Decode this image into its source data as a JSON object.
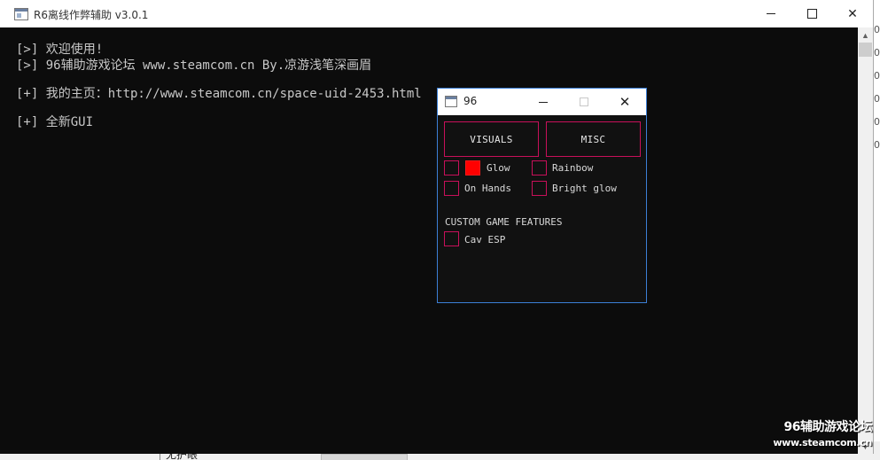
{
  "console_window": {
    "title": "R6离线作弊辅助 v3.0.1",
    "lines": [
      "[>] 欢迎使用!",
      "[>] 96辅助游戏论坛 www.steamcom.cn By.凉游浅笔深画眉",
      "[+] 我的主页：http://www.steamcom.cn/space-uid-2453.html",
      "[+] 全新GUI"
    ]
  },
  "gui_window": {
    "title": "96",
    "tabs": {
      "visuals": "VISUALS",
      "misc": "MISC"
    },
    "options": {
      "glow": {
        "label": "Glow",
        "checked": false,
        "color": "#ff0000"
      },
      "rainbow": {
        "label": "Rainbow",
        "checked": false
      },
      "on_hands": {
        "label": "On Hands",
        "checked": false
      },
      "bright_glow": {
        "label": "Bright glow",
        "checked": false
      }
    },
    "section_title": "CUSTOM GAME FEATURES",
    "cav_esp": {
      "label": "Cav ESP",
      "checked": false
    },
    "accent_color": "#c8105a"
  },
  "background_app": {
    "right_digits": [
      "0",
      "0",
      "0",
      "0",
      "0",
      "0"
    ],
    "bottom_text": "无护眼"
  },
  "watermark": {
    "line1": "96辅助游戏论坛",
    "line2": "www.steamcom.cn"
  }
}
